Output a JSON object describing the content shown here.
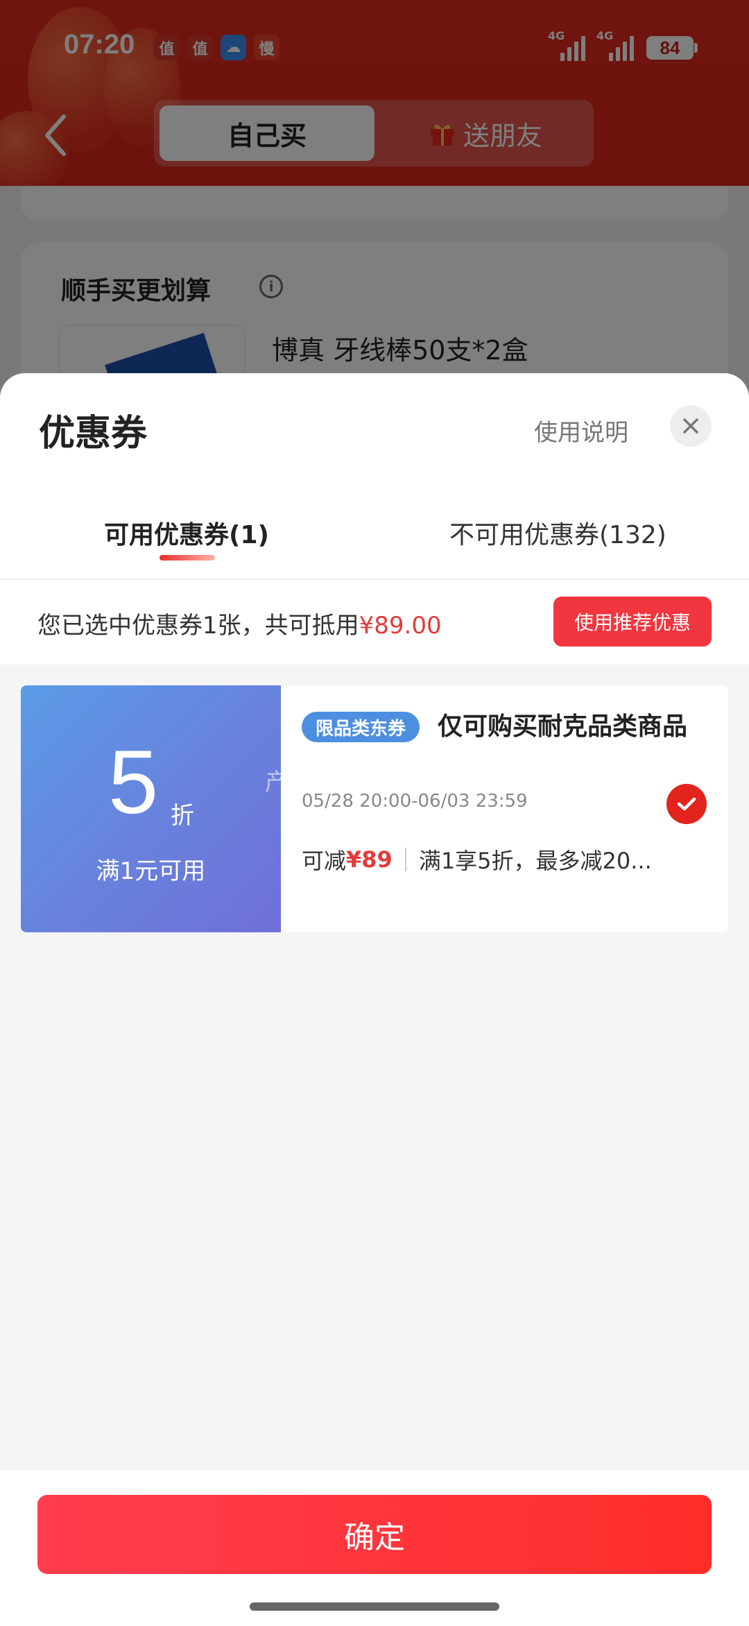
{
  "status_bar": {
    "time": "07:20",
    "app_icons": [
      {
        "char": "值",
        "color": "#d9362b"
      },
      {
        "char": "值",
        "color": "#d9362b"
      },
      {
        "char": "☁",
        "color": "#3b8ff2"
      },
      {
        "char": "慢",
        "color": "#e8452a"
      }
    ],
    "signal_1": "4G",
    "signal_2": "4G",
    "battery": "84"
  },
  "header": {
    "segments": [
      "自己买",
      "送朋友"
    ],
    "active_segment": "自己买"
  },
  "background_page": {
    "section_title": "顺手买更划算",
    "product_name": "博真 牙线棒50支*2盒"
  },
  "sheet": {
    "title": "优惠券",
    "help_link": "使用说明",
    "tabs": [
      "可用优惠券(1)",
      "不可用优惠券(132)"
    ],
    "selection_summary_prefix": "您已选中优惠券1张，共可抵用",
    "selection_amount": "¥89.00",
    "recommend_button": "使用推荐优惠",
    "coupon": {
      "discount": "5",
      "discount_unit": "折",
      "threshold": "满1元可用",
      "watermark": "产品性能优势",
      "tag": "限品类东券",
      "name": "仅可购买耐克品类商品",
      "validity": "05/28 20:00-06/03 23:59",
      "deduct_label": "可减",
      "deduct_amount": "¥89",
      "rule": "满1享5折，最多减20...",
      "selected": true
    },
    "confirm_button": "确定"
  },
  "colors": {
    "brand_red": "#e3231d",
    "coupon_blue": "#5b9be6",
    "price_red": "#e23b3b"
  }
}
